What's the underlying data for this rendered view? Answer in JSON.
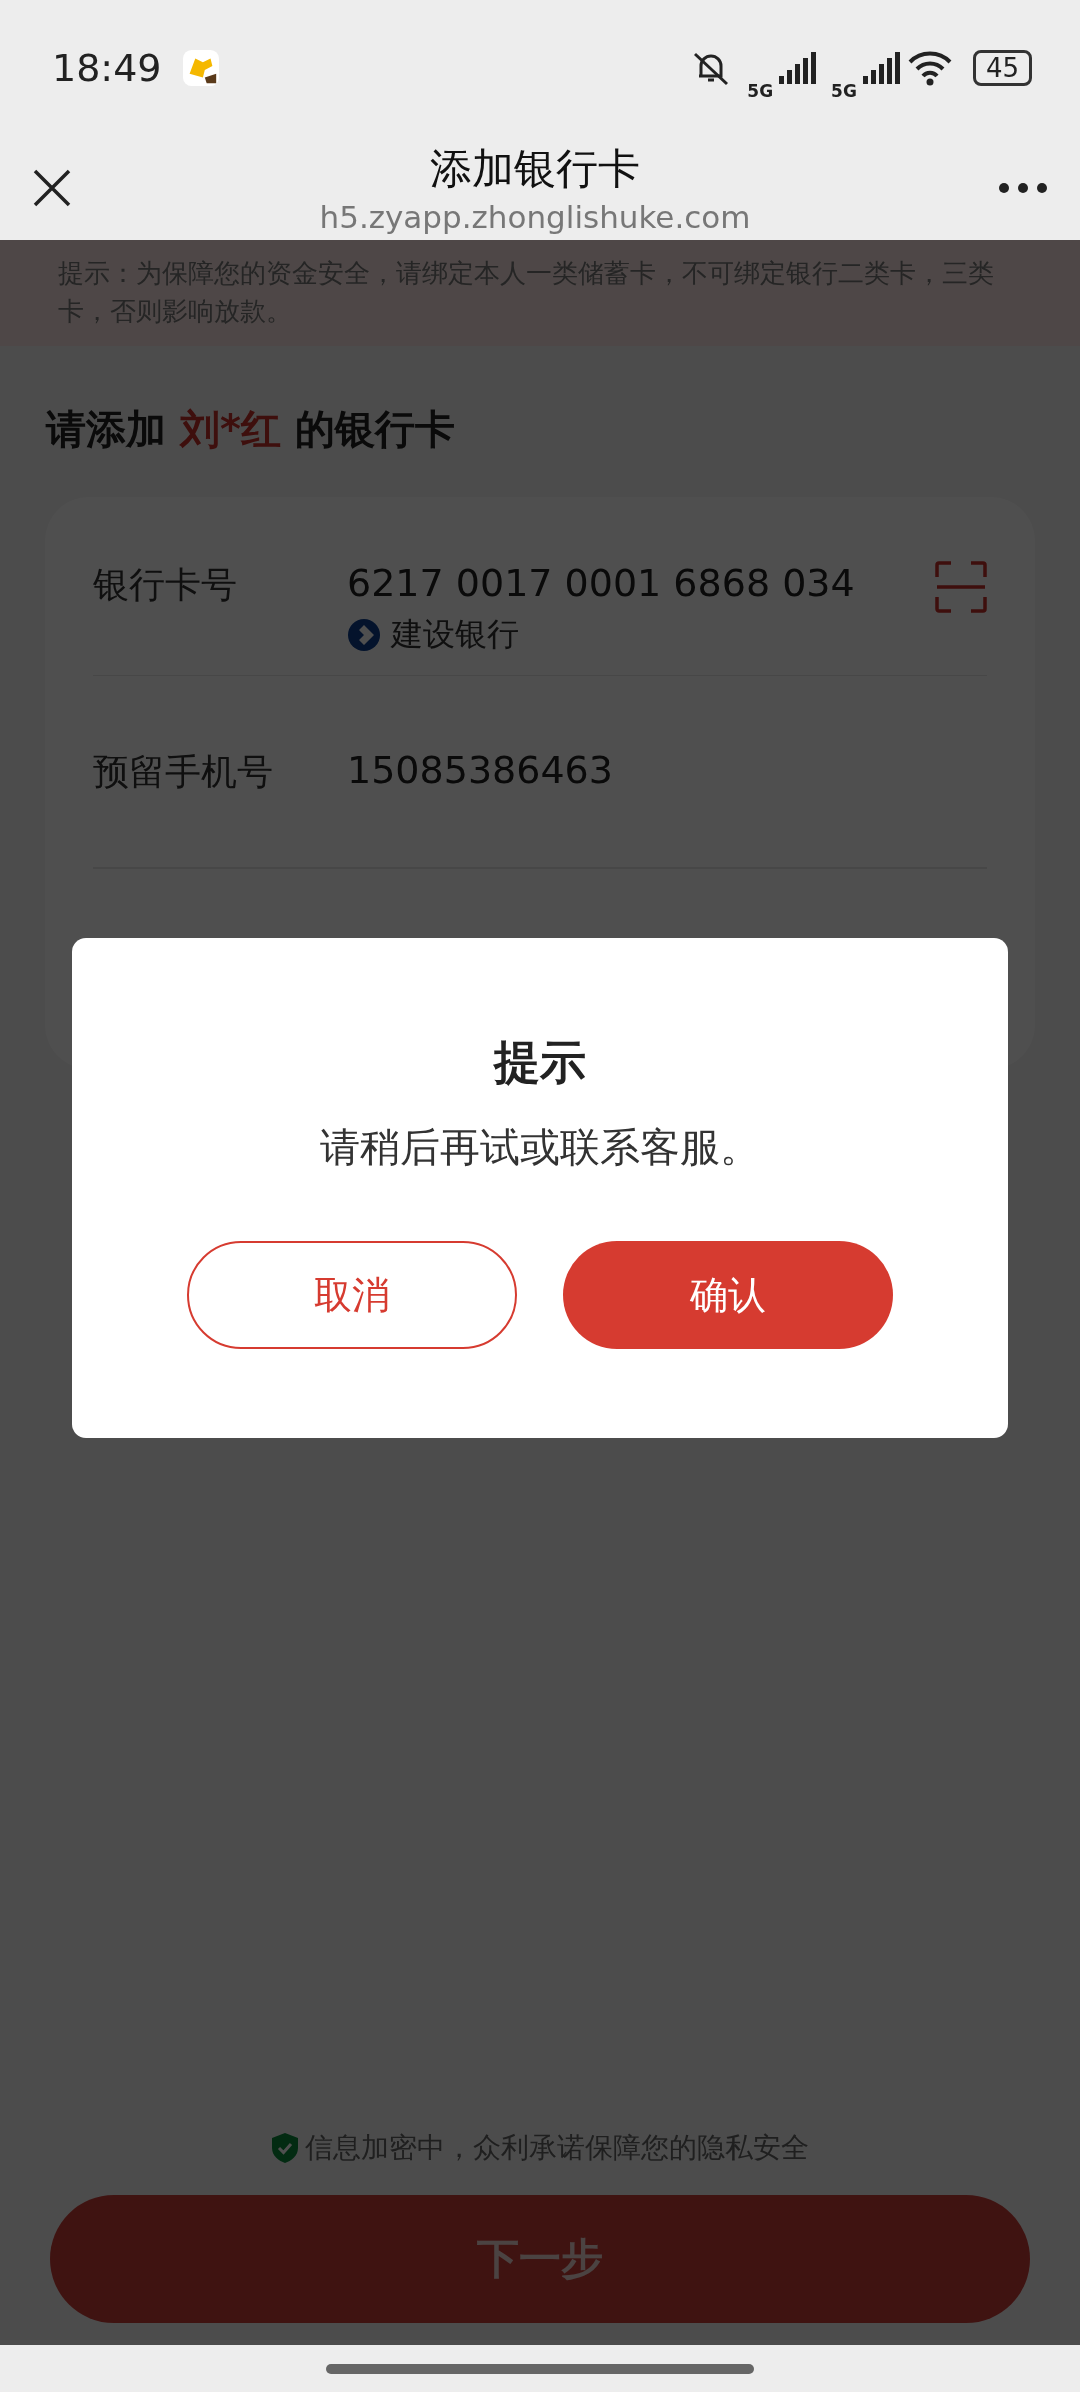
{
  "status_bar": {
    "time": "18:49",
    "networks": [
      "5G",
      "5G"
    ],
    "battery": "45"
  },
  "header": {
    "title": "添加银行卡",
    "url": "h5.zyapp.zhonglishuke.com"
  },
  "notice": "提示：为保障您的资金安全，请绑定本人一类储蓄卡，不可绑定银行二类卡，三类卡，否则影响放款。",
  "heading": {
    "prefix": "请添加",
    "name": "刘*红",
    "suffix": "的银行卡"
  },
  "form_rows": [
    {
      "kind": "card",
      "label": "银行卡号",
      "value": "6217 0017 0001 6868 034",
      "bank": "建设银行"
    },
    {
      "kind": "phone",
      "label": "预留手机号",
      "value": "15085386463"
    }
  ],
  "dialog": {
    "title": "提示",
    "message": "请稍后再试或联系客服。",
    "buttons": [
      {
        "kind": "secondary",
        "label": "取消"
      },
      {
        "kind": "primary",
        "label": "确认"
      }
    ]
  },
  "footer": {
    "security_note": "信息加密中，众利承诺保障您的隐私安全",
    "next_button": "下一步"
  }
}
